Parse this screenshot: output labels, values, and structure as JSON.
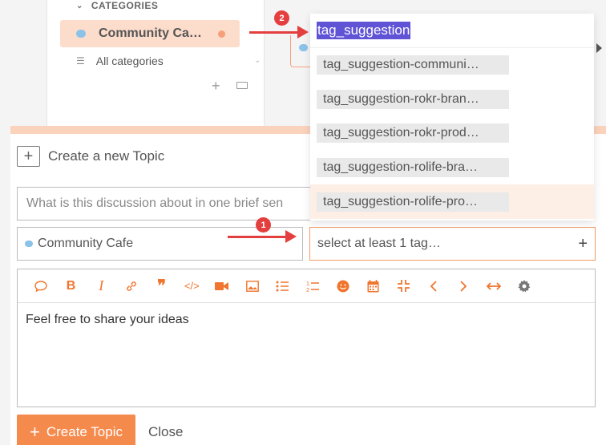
{
  "sidebar": {
    "categories_header": "CATEGORIES",
    "active_category": "Community Ca…",
    "all_categories": "All categories"
  },
  "composer": {
    "create_new_topic": "Create a new Topic",
    "title_placeholder": "What is this discussion about in one brief sen",
    "category_value": "Community Cafe",
    "tag_placeholder": "select at least 1 tag…",
    "editor_text": "Feel free to share your ideas",
    "create_topic_label": "Create Topic",
    "close_label": "Close",
    "toolbar": [
      "quote-bubble",
      "bold",
      "italic",
      "link",
      "blockquote",
      "code",
      "video",
      "image",
      "bullet-list",
      "numbered-list",
      "emoji",
      "calendar",
      "collapse",
      "prev",
      "next",
      "expand",
      "settings"
    ]
  },
  "tag_dropdown": {
    "search_value": "tag_suggestion",
    "items": [
      "tag_suggestion-communi…",
      "tag_suggestion-rokr-bran…",
      "tag_suggestion-rokr-prod…",
      "tag_suggestion-rolife-bra…",
      "tag_suggestion-rolife-pro…"
    ]
  },
  "annotations": {
    "badge_1": "1",
    "badge_2": "2"
  },
  "colors": {
    "accent": "#f58a4d",
    "arrow": "#e43f3f",
    "selection": "#6053d6"
  }
}
